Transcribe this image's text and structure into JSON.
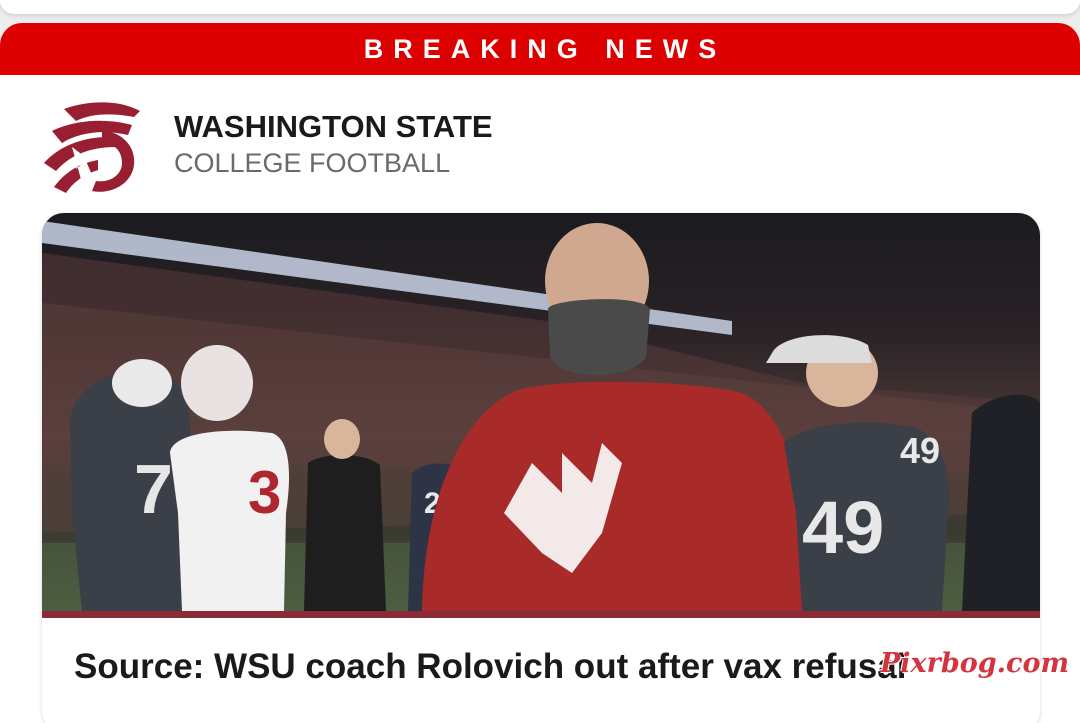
{
  "banner": {
    "label": "BREAKING NEWS"
  },
  "team": {
    "name": "WASHINGTON STATE",
    "league": "COLLEGE FOOTBALL",
    "logo_icon": "wsu-cougar-logo",
    "brand_color": "#981e32"
  },
  "story": {
    "image_icon": "coach-masked-on-field-photo",
    "headline": "Source: WSU coach Rolovich out after vax refusal"
  },
  "watermark": {
    "text": "Pixrbog.com"
  },
  "colors": {
    "accent": "#dc0000",
    "crimson": "#981e32"
  }
}
